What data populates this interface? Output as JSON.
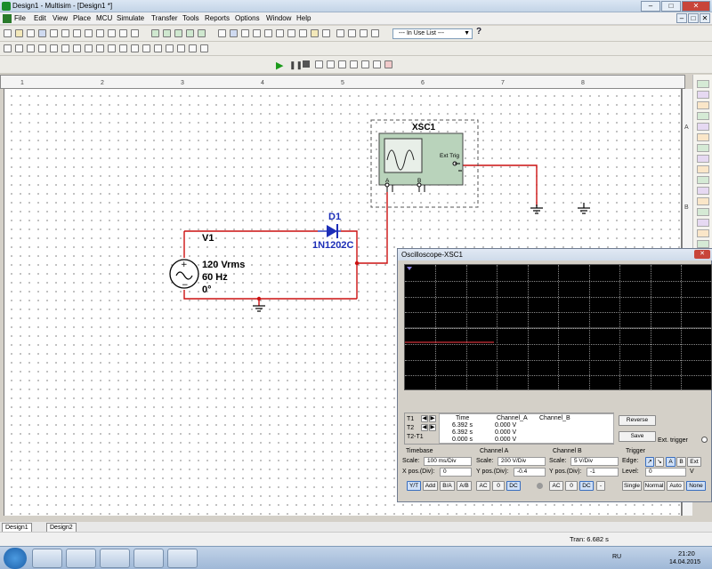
{
  "window": {
    "title": "Design1 - Multisim - [Design1 *]"
  },
  "menu": [
    "File",
    "Edit",
    "View",
    "Place",
    "MCU",
    "Simulate",
    "Transfer",
    "Tools",
    "Reports",
    "Options",
    "Window",
    "Help"
  ],
  "toolbar": {
    "in_use_list": "--- In Use List ---",
    "help": "?"
  },
  "ruler": {
    "top": [
      "1",
      "2",
      "3",
      "4",
      "5",
      "6",
      "7",
      "8"
    ],
    "side": [
      "A",
      "B"
    ]
  },
  "circuit": {
    "source": {
      "ref": "V1",
      "voltage": "120 Vrms",
      "freq": "60 Hz",
      "phase": "0°"
    },
    "diode": {
      "ref": "D1",
      "part": "1N1202C"
    },
    "scope_symbol": {
      "ref": "XSC1",
      "ext_trig": "Ext Trig",
      "ch_a": "A",
      "ch_b": "B"
    }
  },
  "scope": {
    "title": "Oscilloscope-XSC1",
    "close": "✕",
    "readout": {
      "headers": [
        "Time",
        "Channel_A",
        "Channel_B"
      ],
      "rows": [
        {
          "label": "T1",
          "time": "6.392 s",
          "a": "0.000 V",
          "b": ""
        },
        {
          "label": "T2",
          "time": "6.392 s",
          "a": "0.000 V",
          "b": ""
        },
        {
          "label": "T2-T1",
          "time": "0.000 s",
          "a": "0.000 V",
          "b": ""
        }
      ]
    },
    "reverse": "Reverse",
    "save": "Save",
    "ext_trigger": "Ext. trigger",
    "timebase": {
      "title": "Timebase",
      "scale_label": "Scale:",
      "scale": "100 ms/Div",
      "xpos_label": "X pos.(Div):",
      "xpos": "0",
      "modes": [
        "Y/T",
        "Add",
        "B/A",
        "A/B"
      ]
    },
    "channel_a": {
      "title": "Channel A",
      "scale_label": "Scale:",
      "scale": "200  V/Div",
      "ypos_label": "Y pos.(Div):",
      "ypos": "-0.4",
      "coupling": [
        "AC",
        "0",
        "DC"
      ]
    },
    "channel_b": {
      "title": "Channel B",
      "scale_label": "Scale:",
      "scale": "5  V/Div",
      "ypos_label": "Y pos.(Div):",
      "ypos": "-1",
      "coupling": [
        "AC",
        "0",
        "DC",
        "-"
      ]
    },
    "trigger": {
      "title": "Trigger",
      "edge_label": "Edge:",
      "sources": [
        "A",
        "B",
        "Ext"
      ],
      "level_label": "Level:",
      "level": "0",
      "level_unit": "V",
      "modes": [
        "Single",
        "Normal",
        "Auto",
        "None"
      ]
    }
  },
  "tabs": [
    "Design1",
    "Design2"
  ],
  "status": {
    "tran": "Tran: 6.682 s"
  },
  "taskbar": {
    "lang": "RU",
    "time": "21:20",
    "date": "14.04.2015"
  }
}
